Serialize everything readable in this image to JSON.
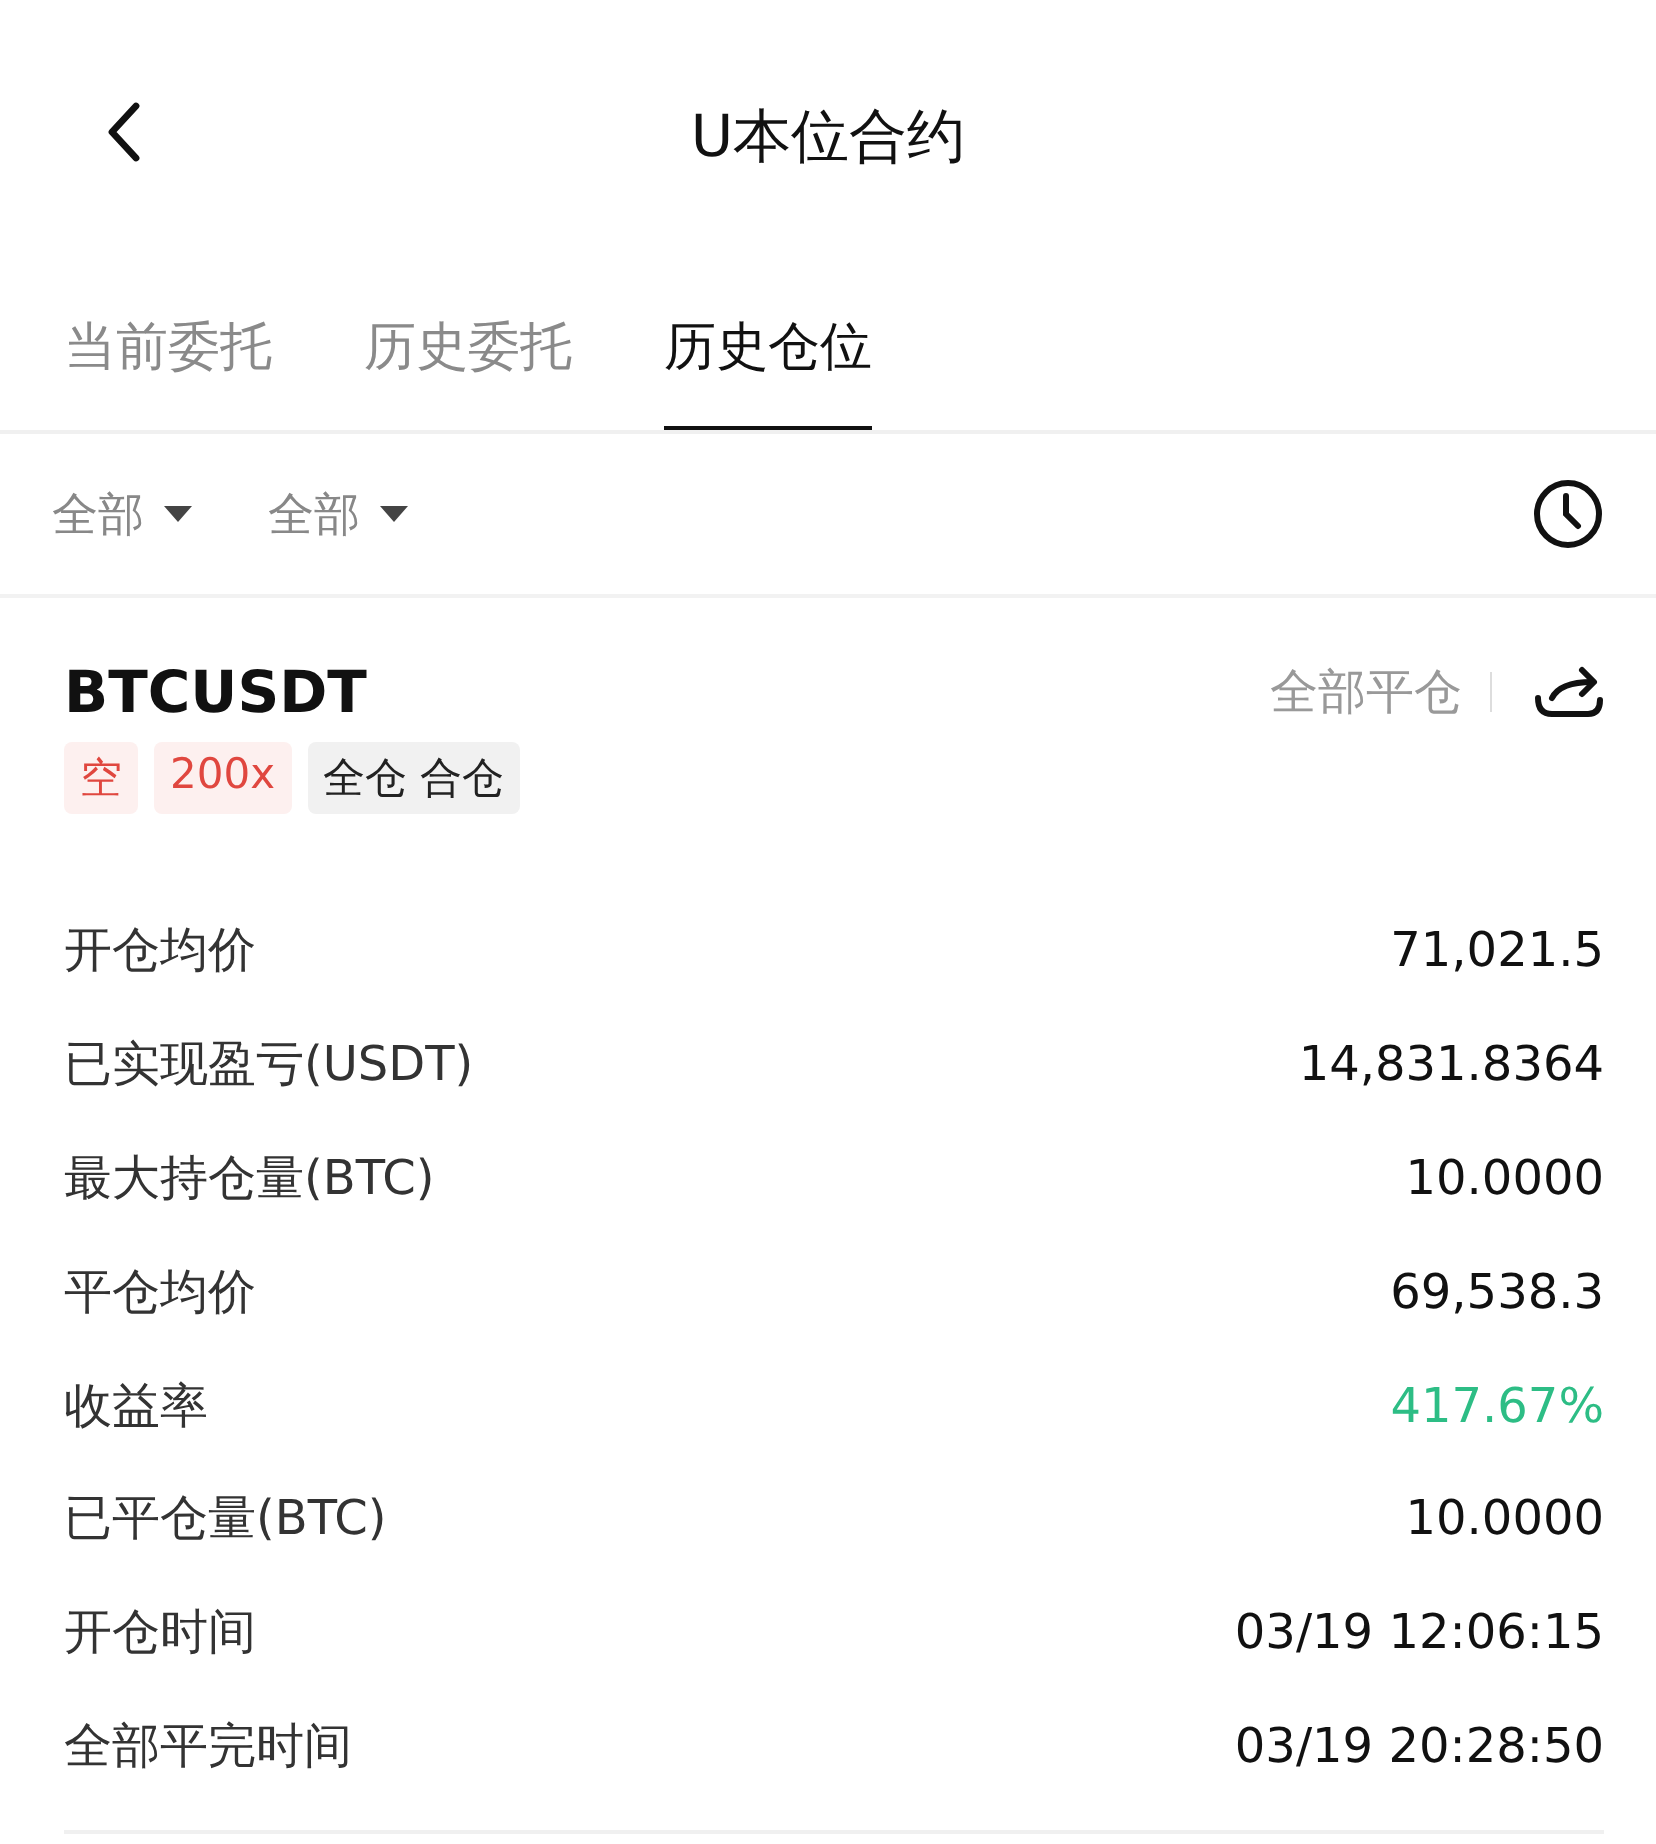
{
  "header": {
    "title": "U本位合约"
  },
  "tabs": [
    {
      "label": "当前委托",
      "selected": false
    },
    {
      "label": "历史委托",
      "selected": false
    },
    {
      "label": "历史仓位",
      "selected": true
    }
  ],
  "filters": [
    {
      "label": "全部"
    },
    {
      "label": "全部"
    }
  ],
  "position": {
    "symbol": "BTCUSDT",
    "close_all": "全部平仓",
    "tags": [
      {
        "label": "空",
        "kind": "side"
      },
      {
        "label": "200x",
        "kind": "side"
      },
      {
        "label": "全仓 合仓",
        "kind": "mode"
      }
    ],
    "rows": [
      {
        "label": "开仓均价",
        "value": "71,021.5",
        "kind": "plain"
      },
      {
        "label": "已实现盈亏(USDT)",
        "value": "14,831.8364",
        "kind": "plain"
      },
      {
        "label": "最大持仓量(BTC)",
        "value": "10.0000",
        "kind": "plain"
      },
      {
        "label": "平仓均价",
        "value": "69,538.3",
        "kind": "plain"
      },
      {
        "label": "收益率",
        "value": "417.67%",
        "kind": "profit"
      },
      {
        "label": "已平仓量(BTC)",
        "value": "10.0000",
        "kind": "plain"
      },
      {
        "label": "开仓时间",
        "value": "03/19 12:06:15",
        "kind": "plain"
      },
      {
        "label": "全部平完时间",
        "value": "03/19 20:28:50",
        "kind": "plain"
      }
    ]
  }
}
